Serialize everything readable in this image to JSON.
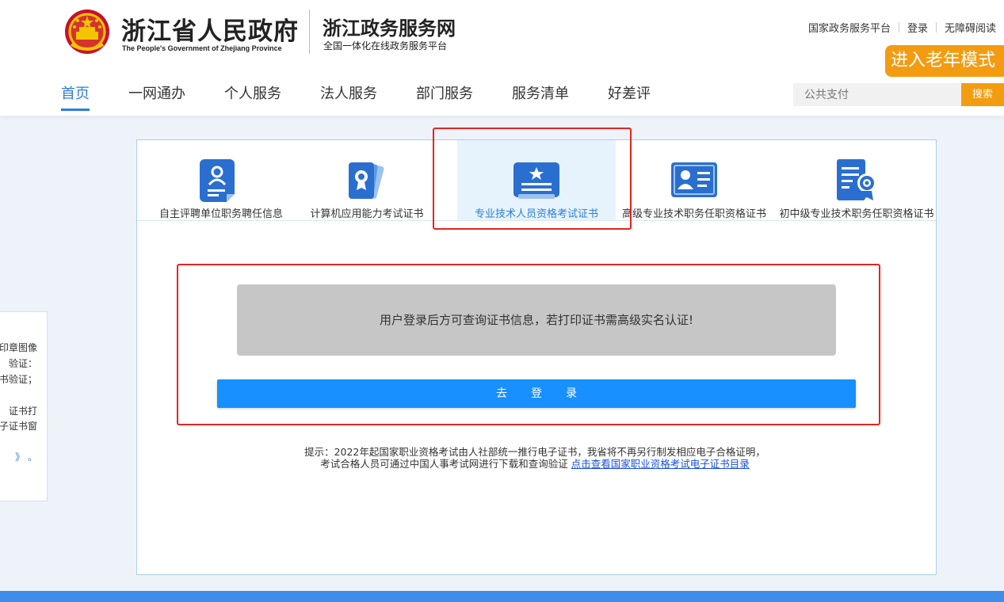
{
  "header": {
    "gov_title": "浙江省人民政府",
    "gov_subtitle": "The People's Government of Zhejiang Province",
    "service_title": "浙江政务服务网",
    "service_subtitle": "全国一体化在线政务服务平台",
    "top_links": [
      "国家政务服务平台",
      "登录",
      "无障碍阅读"
    ],
    "elder_mode": "进入老年模式",
    "search_placeholder": "公共支付",
    "search_button": "搜索"
  },
  "nav": {
    "items": [
      "首页",
      "一网通办",
      "个人服务",
      "法人服务",
      "部门服务",
      "服务清单",
      "好差评"
    ],
    "active_index": 0
  },
  "side_panel": {
    "lines": [
      "印章图像",
      "验证：",
      "书验证；",
      "证书打",
      "子证书窗",
      "》 。"
    ]
  },
  "tabs": [
    {
      "label": "自主评聘单位职务聘任信息",
      "icon": "person-document-icon"
    },
    {
      "label": "计算机应用能力考试证书",
      "icon": "certificate-cards-icon"
    },
    {
      "label": "专业技术人员资格考试证书",
      "icon": "star-card-icon"
    },
    {
      "label": "高级专业技术职务任职资格证书",
      "icon": "id-card-icon"
    },
    {
      "label": "初中级专业技术职务任职资格证书",
      "icon": "document-badge-icon"
    }
  ],
  "active_tab": 2,
  "main": {
    "notice": "用户登录后方可查询证书信息，若打印证书需高级实名认证!",
    "login_button": "去登录",
    "tip_line1": "提示：2022年起国家职业资格考试由人社部统一推行电子证书，我省将不再另行制发相应电子合格证明，",
    "tip_line2": "考试合格人员可通过中国人事考试网进行下载和查询验证",
    "tip_link": "点击查看国家职业资格考试电子证书目录"
  },
  "colors": {
    "primary_blue": "#2b7fd8",
    "button_blue": "#1890ff",
    "orange": "#f39c12",
    "highlight_red": "#e8231f",
    "icon_blue": "#2a6fcf"
  }
}
